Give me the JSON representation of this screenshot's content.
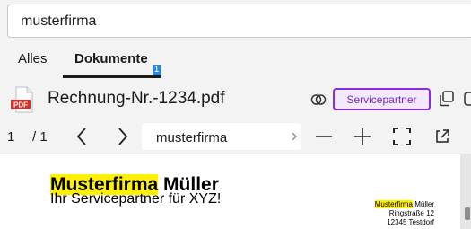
{
  "search": {
    "query": "musterfirma"
  },
  "tabs": [
    {
      "label": "Alles"
    },
    {
      "label": "Dokumente",
      "badge": "1",
      "selected": true
    }
  ],
  "file": {
    "icon_label": "PDF",
    "name": "Rechnung-Nr.-1234.pdf",
    "service_button": "Servicepartner"
  },
  "toolbar": {
    "page_current": "1",
    "page_total": "/ 1",
    "find_query": "musterfirma"
  },
  "document": {
    "title_highlight": "Musterfirma",
    "title_rest": " Müller",
    "subtitle": "Ihr Servicepartner für XYZ!",
    "address_highlight": "Musterfirma",
    "address_line1_rest": " Müller",
    "address_line2": "Ringstraße 12",
    "address_line3": "12345 Testdorf"
  },
  "colors": {
    "accent": "#8a2be2",
    "badge": "#2e86d6",
    "highlight": "#fff000",
    "pdf_red": "#d93025"
  },
  "icons": [
    "pdf-file-icon",
    "link-icon",
    "copy-icon",
    "chevron-left-icon",
    "chevron-right-icon",
    "minus-icon",
    "plus-icon",
    "fullscreen-icon",
    "open-external-icon"
  ]
}
